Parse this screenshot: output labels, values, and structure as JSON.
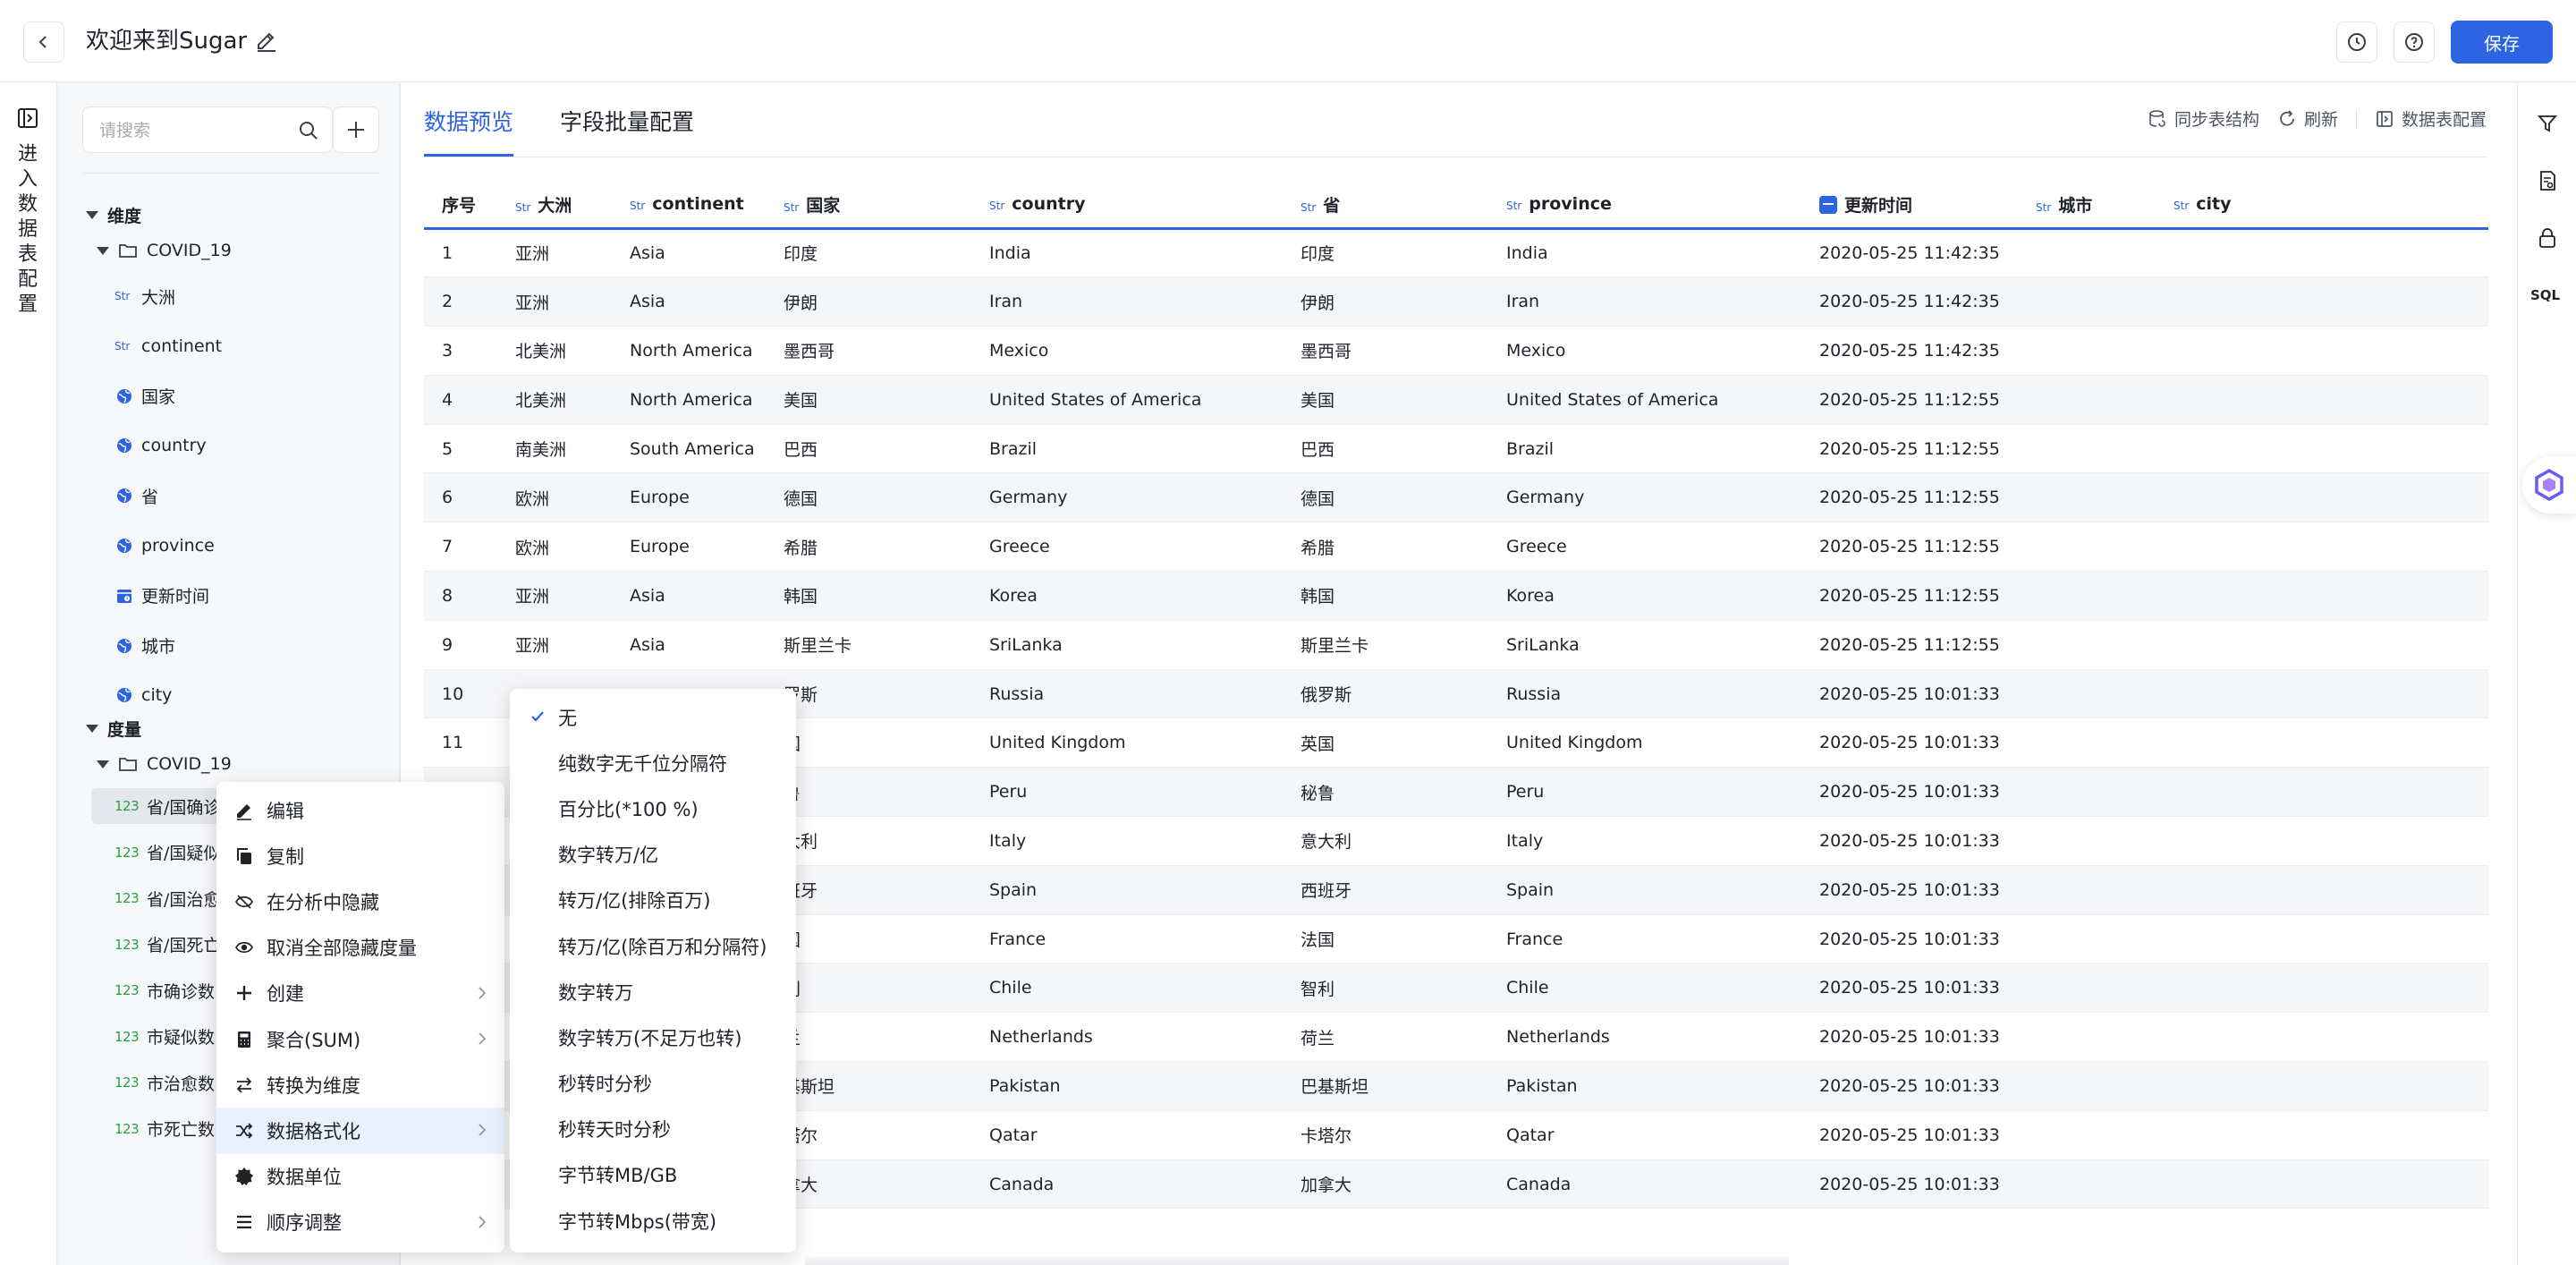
{
  "header": {
    "title": "欢迎来到Sugar",
    "save_label": "保存"
  },
  "left_rail": {
    "label": "进入数据表配置"
  },
  "field_panel": {
    "search_placeholder": "请搜索",
    "dimensions": {
      "title": "维度",
      "group": "COVID_19",
      "fields": [
        {
          "type": "Str",
          "label": "大洲"
        },
        {
          "type": "Str",
          "label": "continent"
        },
        {
          "type": "geo",
          "label": "国家"
        },
        {
          "type": "geo",
          "label": "country"
        },
        {
          "type": "geo",
          "label": "省"
        },
        {
          "type": "geo",
          "label": "province"
        },
        {
          "type": "date",
          "label": "更新时间"
        },
        {
          "type": "geo",
          "label": "城市"
        },
        {
          "type": "geo",
          "label": "city"
        }
      ]
    },
    "measures": {
      "title": "度量",
      "group": "COVID_19",
      "fields": [
        {
          "type": "123",
          "label": "省/国确诊"
        },
        {
          "type": "123",
          "label": "省/国疑似"
        },
        {
          "type": "123",
          "label": "省/国治愈"
        },
        {
          "type": "123",
          "label": "省/国死亡"
        },
        {
          "type": "123",
          "label": "市确诊数"
        },
        {
          "type": "123",
          "label": "市疑似数"
        },
        {
          "type": "123",
          "label": "市治愈数"
        },
        {
          "type": "123",
          "label": "市死亡数"
        }
      ]
    }
  },
  "main": {
    "tabs": [
      {
        "label": "数据预览",
        "active": true
      },
      {
        "label": "字段批量配置",
        "active": false
      }
    ],
    "actions": {
      "sync": "同步表结构",
      "refresh": "刷新",
      "config": "数据表配置"
    },
    "table": {
      "columns": [
        {
          "badge": "",
          "label": "序号"
        },
        {
          "badge": "Str",
          "label": "大洲"
        },
        {
          "badge": "Str",
          "label": "continent"
        },
        {
          "badge": "Str",
          "label": "国家"
        },
        {
          "badge": "Str",
          "label": "country"
        },
        {
          "badge": "Str",
          "label": "省"
        },
        {
          "badge": "Str",
          "label": "province"
        },
        {
          "badge": "date",
          "label": "更新时间"
        },
        {
          "badge": "Str",
          "label": "城市"
        },
        {
          "badge": "Str",
          "label": "city"
        }
      ],
      "rows": [
        [
          "1",
          "亚洲",
          "Asia",
          "印度",
          "India",
          "印度",
          "India",
          "2020-05-25 11:42:35",
          "",
          ""
        ],
        [
          "2",
          "亚洲",
          "Asia",
          "伊朗",
          "Iran",
          "伊朗",
          "Iran",
          "2020-05-25 11:42:35",
          "",
          ""
        ],
        [
          "3",
          "北美洲",
          "North America",
          "墨西哥",
          "Mexico",
          "墨西哥",
          "Mexico",
          "2020-05-25 11:42:35",
          "",
          ""
        ],
        [
          "4",
          "北美洲",
          "North America",
          "美国",
          "United States of America",
          "美国",
          "United States of America",
          "2020-05-25 11:12:55",
          "",
          ""
        ],
        [
          "5",
          "南美洲",
          "South America",
          "巴西",
          "Brazil",
          "巴西",
          "Brazil",
          "2020-05-25 11:12:55",
          "",
          ""
        ],
        [
          "6",
          "欧洲",
          "Europe",
          "德国",
          "Germany",
          "德国",
          "Germany",
          "2020-05-25 11:12:55",
          "",
          ""
        ],
        [
          "7",
          "欧洲",
          "Europe",
          "希腊",
          "Greece",
          "希腊",
          "Greece",
          "2020-05-25 11:12:55",
          "",
          ""
        ],
        [
          "8",
          "亚洲",
          "Asia",
          "韩国",
          "Korea",
          "韩国",
          "Korea",
          "2020-05-25 11:12:55",
          "",
          ""
        ],
        [
          "9",
          "亚洲",
          "Asia",
          "斯里兰卡",
          "SriLanka",
          "斯里兰卡",
          "SriLanka",
          "2020-05-25 11:12:55",
          "",
          ""
        ],
        [
          "10",
          "",
          "",
          "罗斯",
          "Russia",
          "俄罗斯",
          "Russia",
          "2020-05-25 10:01:33",
          "",
          ""
        ],
        [
          "11",
          "",
          "",
          "国",
          "United Kingdom",
          "英国",
          "United Kingdom",
          "2020-05-25 10:01:33",
          "",
          ""
        ],
        [
          "",
          "",
          "",
          "鲁",
          "Peru",
          "秘鲁",
          "Peru",
          "2020-05-25 10:01:33",
          "",
          ""
        ],
        [
          "",
          "",
          "",
          "大利",
          "Italy",
          "意大利",
          "Italy",
          "2020-05-25 10:01:33",
          "",
          ""
        ],
        [
          "",
          "",
          "",
          "班牙",
          "Spain",
          "西班牙",
          "Spain",
          "2020-05-25 10:01:33",
          "",
          ""
        ],
        [
          "",
          "",
          "",
          "国",
          "France",
          "法国",
          "France",
          "2020-05-25 10:01:33",
          "",
          ""
        ],
        [
          "",
          "",
          "",
          "利",
          "Chile",
          "智利",
          "Chile",
          "2020-05-25 10:01:33",
          "",
          ""
        ],
        [
          "",
          "",
          "",
          "兰",
          "Netherlands",
          "荷兰",
          "Netherlands",
          "2020-05-25 10:01:33",
          "",
          ""
        ],
        [
          "",
          "",
          "",
          "基斯坦",
          "Pakistan",
          "巴基斯坦",
          "Pakistan",
          "2020-05-25 10:01:33",
          "",
          ""
        ],
        [
          "",
          "",
          "",
          "塔尔",
          "Qatar",
          "卡塔尔",
          "Qatar",
          "2020-05-25 10:01:33",
          "",
          ""
        ],
        [
          "",
          "",
          "",
          "拿大",
          "Canada",
          "加拿大",
          "Canada",
          "2020-05-25 10:01:33",
          "",
          ""
        ]
      ]
    }
  },
  "context_menu": {
    "items": [
      {
        "icon": "edit-icon",
        "label": "编辑",
        "submenu": false
      },
      {
        "icon": "copy-icon",
        "label": "复制",
        "submenu": false
      },
      {
        "icon": "eye-off-icon",
        "label": "在分析中隐藏",
        "submenu": false
      },
      {
        "icon": "eye-icon",
        "label": "取消全部隐藏度量",
        "submenu": false
      },
      {
        "icon": "plus-icon",
        "label": "创建",
        "submenu": true
      },
      {
        "icon": "calculator-icon",
        "label": "聚合(SUM)",
        "submenu": true
      },
      {
        "icon": "swap-icon",
        "label": "转换为维度",
        "submenu": false
      },
      {
        "icon": "shuffle-icon",
        "label": "数据格式化",
        "submenu": true,
        "active": true
      },
      {
        "icon": "badge-icon",
        "label": "数据单位",
        "submenu": false
      },
      {
        "icon": "list-icon",
        "label": "顺序调整",
        "submenu": true
      }
    ]
  },
  "format_submenu": {
    "items": [
      {
        "label": "无",
        "checked": true
      },
      {
        "label": "纯数字无千位分隔符",
        "checked": false
      },
      {
        "label": "百分比(*100 %)",
        "checked": false
      },
      {
        "label": "数字转万/亿",
        "checked": false
      },
      {
        "label": "转万/亿(排除百万)",
        "checked": false
      },
      {
        "label": "转万/亿(除百万和分隔符)",
        "checked": false
      },
      {
        "label": "数字转万",
        "checked": false
      },
      {
        "label": "数字转万(不足万也转)",
        "checked": false
      },
      {
        "label": "秒转时分秒",
        "checked": false
      },
      {
        "label": "秒转天时分秒",
        "checked": false
      },
      {
        "label": "字节转MB/GB",
        "checked": false
      },
      {
        "label": "字节转Mbps(带宽)",
        "checked": false
      }
    ]
  },
  "right_rail": {
    "sql_label": "SQL"
  },
  "colors": {
    "accent": "#2c64e3",
    "measure_green": "#25a244"
  }
}
